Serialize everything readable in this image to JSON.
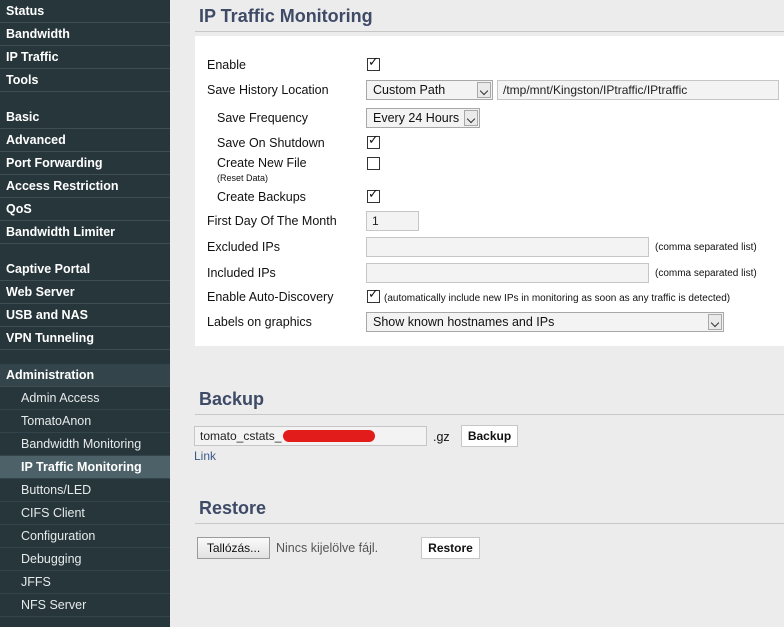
{
  "sidebar": {
    "group1": [
      "Status",
      "Bandwidth",
      "IP Traffic",
      "Tools"
    ],
    "group2": [
      "Basic",
      "Advanced",
      "Port Forwarding",
      "Access Restriction",
      "QoS",
      "Bandwidth Limiter"
    ],
    "group3": [
      "Captive Portal",
      "Web Server",
      "USB and NAS",
      "VPN Tunneling"
    ],
    "admin_header": "Administration",
    "admin_items": [
      "Admin Access",
      "TomatoAnon",
      "Bandwidth Monitoring",
      "IP Traffic Monitoring",
      "Buttons/LED",
      "CIFS Client",
      "Configuration",
      "Debugging",
      "JFFS",
      "NFS Server"
    ],
    "active_item": "IP Traffic Monitoring"
  },
  "main": {
    "title": "IP Traffic Monitoring",
    "enable_label": "Enable",
    "enable_checked": true,
    "history_location_label": "Save History Location",
    "history_location_value": "Custom Path",
    "history_path_value": "/tmp/mnt/Kingston/IPtraffic/IPtraffic",
    "save_frequency_label": "Save Frequency",
    "save_frequency_value": "Every 24 Hours",
    "save_on_shutdown_label": "Save On Shutdown",
    "save_on_shutdown_checked": true,
    "create_new_file_label": "Create New File",
    "create_new_file_note": "(Reset Data)",
    "create_new_file_checked": false,
    "create_backups_label": "Create Backups",
    "create_backups_checked": true,
    "first_day_label": "First Day Of The Month",
    "first_day_value": "1",
    "excluded_ips_label": "Excluded IPs",
    "excluded_ips_value": "",
    "excluded_ips_hint": "(comma separated list)",
    "included_ips_label": "Included IPs",
    "included_ips_value": "",
    "included_ips_hint": "(comma separated list)",
    "auto_discovery_label": "Enable Auto-Discovery",
    "auto_discovery_checked": true,
    "auto_discovery_hint": "(automatically include new IPs in monitoring as soon as any traffic is detected)",
    "labels_graphics_label": "Labels on graphics",
    "labels_graphics_value": "Show known hostnames and IPs"
  },
  "backup": {
    "title": "Backup",
    "filename_value": "tomato_cstats_",
    "extension": ".gz",
    "button_label": "Backup",
    "link_label": "Link"
  },
  "restore": {
    "title": "Restore",
    "browse_label": "Tallózás...",
    "no_file_label": "Nincs kijelölve fájl.",
    "button_label": "Restore"
  }
}
